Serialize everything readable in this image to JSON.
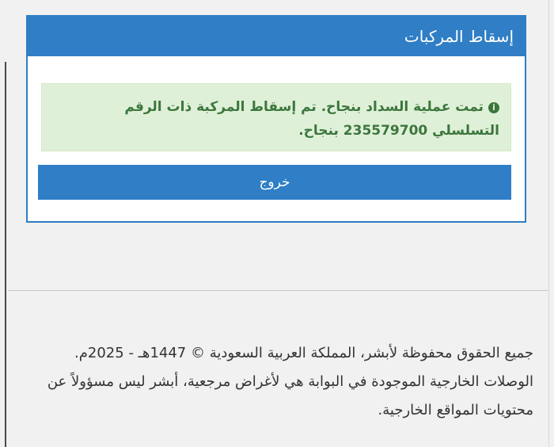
{
  "panel": {
    "title": "إسقاط المركبات",
    "alert": {
      "icon": "info-icon",
      "message_part1": "تمت عملية السداد بنجاح. تم إسقاط المركبة ذات الرقم التسلسلي ",
      "serial": "235579700",
      "message_part2": " بنجاح."
    },
    "exit_label": "خروج"
  },
  "footer": {
    "copyright": "جميع الحقوق محفوظة لأبشر، المملكة العربية السعودية © 1447هـ - 2025م.",
    "disclaimer": "الوصلات الخارجية الموجودة في البوابة هي لأغراض مرجعية، أبشر ليس مسؤولاً عن محتويات المواقع الخارجية."
  },
  "colors": {
    "primary": "#2f7ec6",
    "success_bg": "#dff0d8",
    "success_text": "#3c763d"
  }
}
